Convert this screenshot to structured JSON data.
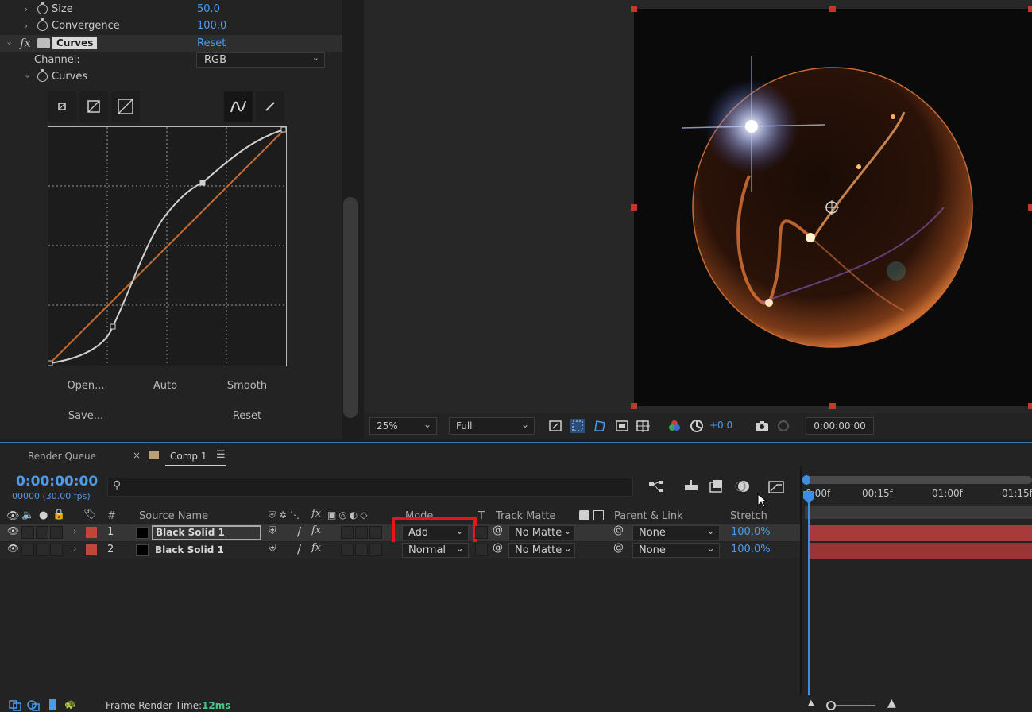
{
  "effect_controls": {
    "rows": [
      {
        "label": "Size",
        "value": "50.0"
      },
      {
        "label": "Convergence",
        "value": "100.0"
      }
    ],
    "effect": {
      "fx": "fx",
      "name": "Curves",
      "reset": "Reset"
    },
    "channel": {
      "label": "Channel:",
      "value": "RGB"
    },
    "curves_label": "Curves",
    "buttons": {
      "open": "Open...",
      "auto": "Auto",
      "smooth": "Smooth",
      "save": "Save...",
      "reset": "Reset"
    }
  },
  "viewer": {
    "zoom": "25%",
    "resolution": "Full",
    "exposure": "+0.0",
    "timecode": "0:00:00:00"
  },
  "timeline": {
    "tabs": [
      {
        "label": "Render Queue"
      },
      {
        "label": "Comp 1"
      }
    ],
    "current_time": "0:00:00:00",
    "frame_info": "00000 (30.00 fps)",
    "search_placeholder": "",
    "columns": {
      "number": "#",
      "source_name": "Source Name",
      "mode": "Mode",
      "t": "T",
      "track_matte": "Track Matte",
      "parent_link": "Parent & Link",
      "stretch": "Stretch"
    },
    "ruler": [
      "0:00f",
      "00:15f",
      "01:00f",
      "01:15f"
    ],
    "layers": [
      {
        "number": "1",
        "name": "Black Solid 1",
        "mode": "Add",
        "track_matte": "No Matte",
        "parent": "None",
        "stretch": "100.0%"
      },
      {
        "number": "2",
        "name": "Black Solid 1",
        "mode": "Normal",
        "track_matte": "No Matte",
        "parent": "None",
        "stretch": "100.0%"
      }
    ],
    "footer": {
      "label": "Frame Render Time:",
      "value": "12ms"
    }
  },
  "colors": {
    "accent": "#4d9bec",
    "label_red": "#c0463a",
    "highlight": "#e8141d",
    "curve_line": "#c26a33"
  }
}
